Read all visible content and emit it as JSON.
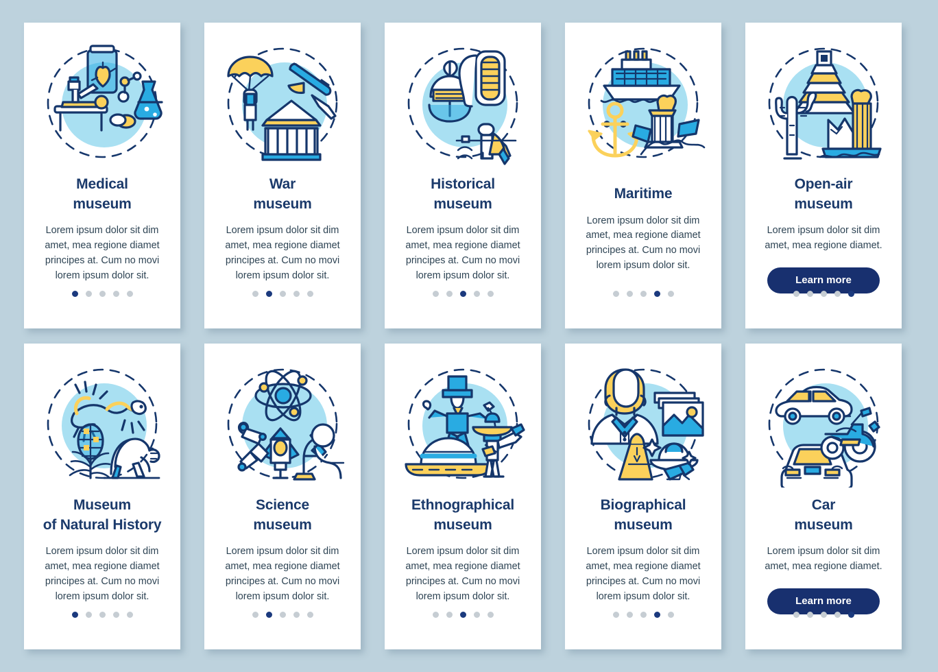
{
  "meta": {
    "background_color": "#bdd2dd",
    "card_color": "#ffffff",
    "title_color": "#1b3a6b",
    "body_color": "#2e4454",
    "accent_navy": "#18306f",
    "accent_cyan": "#a9e0f2",
    "accent_yellow": "#fbd15b",
    "accent_blue": "#29abe2",
    "dot_inactive": "#c6cdd3",
    "dot_active": "#1b3a7e",
    "total_dots": 5
  },
  "cards": [
    {
      "icon_name": "medical-museum-icon",
      "title": "Medical\nmuseum",
      "description": "Lorem ipsum dolor sit dim amet, mea regione diamet principes at. Cum no movi lorem ipsum dolor sit.",
      "active_dot": 1,
      "has_button": false,
      "button_label": ""
    },
    {
      "icon_name": "war-museum-icon",
      "title": "War\nmuseum",
      "description": "Lorem ipsum dolor sit dim amet, mea regione diamet principes at. Cum no movi lorem ipsum dolor sit.",
      "active_dot": 2,
      "has_button": false,
      "button_label": ""
    },
    {
      "icon_name": "historical-museum-icon",
      "title": "Historical\nmuseum",
      "description": "Lorem ipsum dolor sit dim amet, mea regione diamet principes at. Cum no movi lorem ipsum dolor sit.",
      "active_dot": 3,
      "has_button": false,
      "button_label": ""
    },
    {
      "icon_name": "maritime-museum-icon",
      "title": "Maritime",
      "description": "Lorem ipsum dolor sit dim amet, mea regione diamet principes at. Cum no movi lorem ipsum dolor sit.",
      "active_dot": 4,
      "has_button": false,
      "button_label": ""
    },
    {
      "icon_name": "open-air-museum-icon",
      "title": "Open-air\nmuseum",
      "description": "Lorem ipsum dolor sit dim amet, mea regione diamet.",
      "active_dot": 5,
      "has_button": true,
      "button_label": "Learn more"
    },
    {
      "icon_name": "natural-history-museum-icon",
      "title": "Museum\nof Natural History",
      "description": "Lorem ipsum dolor sit dim amet, mea regione diamet principes at. Cum no movi lorem ipsum dolor sit.",
      "active_dot": 1,
      "has_button": false,
      "button_label": ""
    },
    {
      "icon_name": "science-museum-icon",
      "title": "Science\nmuseum",
      "description": "Lorem ipsum dolor sit dim amet, mea regione diamet principes at. Cum no movi lorem ipsum dolor sit.",
      "active_dot": 2,
      "has_button": false,
      "button_label": ""
    },
    {
      "icon_name": "ethnographical-museum-icon",
      "title": "Ethnographical\nmuseum",
      "description": "Lorem ipsum dolor sit dim amet, mea regione diamet principes at. Cum no movi lorem ipsum dolor sit.",
      "active_dot": 3,
      "has_button": false,
      "button_label": ""
    },
    {
      "icon_name": "biographical-museum-icon",
      "title": "Biographical\nmuseum",
      "description": "Lorem ipsum dolor sit dim amet, mea regione diamet principes at. Cum no movi lorem ipsum dolor sit.",
      "active_dot": 4,
      "has_button": false,
      "button_label": ""
    },
    {
      "icon_name": "car-museum-icon",
      "title": "Car\nmuseum",
      "description": "Lorem ipsum dolor sit dim amet, mea regione diamet.",
      "active_dot": 5,
      "has_button": true,
      "button_label": "Learn more"
    }
  ]
}
